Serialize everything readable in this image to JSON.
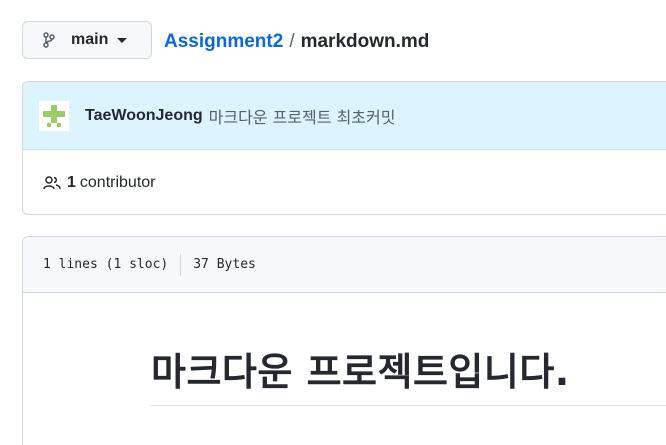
{
  "branch": {
    "label": "main",
    "icon": "git-branch-icon"
  },
  "breadcrumb": {
    "repo": "Assignment2",
    "separator": "/",
    "file": "markdown.md"
  },
  "commit": {
    "author": "TaeWoonJeong",
    "message": "마크다운 프로젝트 최초커밋",
    "contributors_count": "1",
    "contributors_label": "contributor"
  },
  "file": {
    "lines": "1 lines (1 sloc)",
    "size": "37 Bytes",
    "content_heading": "마크다운 프로젝트입니다."
  },
  "colors": {
    "link": "#0969da",
    "commit_bg": "#ddf4ff",
    "header_bg": "#f6f8fa",
    "border": "#d0d7de"
  }
}
